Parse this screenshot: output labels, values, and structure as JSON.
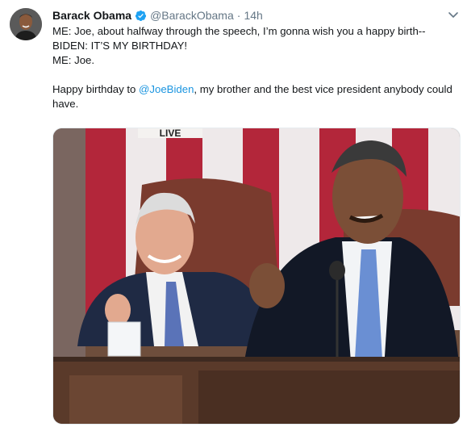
{
  "tweet": {
    "author_name": "Barack Obama",
    "handle": "@BarackObama",
    "separator": "·",
    "time": "14h",
    "lines": [
      "ME:  Joe, about halfway through the speech, I’m gonna wish you a happy birth--",
      "BIDEN:  IT’S MY BIRTHDAY!",
      "ME:  Joe."
    ],
    "para_before": "Happy birthday to ",
    "mention": "@JoeBiden",
    "para_after": ", my brother and the best vice president anybody could have."
  },
  "media": {
    "overlay_text": "LIVE"
  },
  "icons": {
    "verified": "verified-badge-icon",
    "menu": "chevron-down-icon"
  },
  "colors": {
    "link": "#1b95e0",
    "verified": "#1da1f2",
    "muted": "#657786"
  }
}
